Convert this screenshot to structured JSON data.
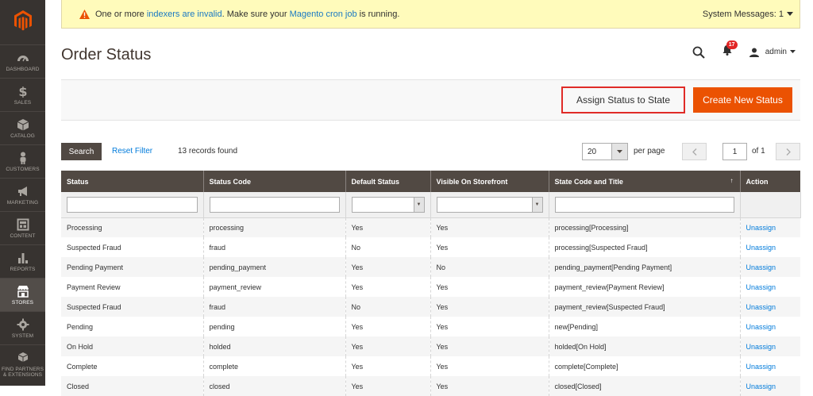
{
  "sidebar": {
    "items": [
      {
        "label": "DASHBOARD",
        "icon": "dashboard-icon"
      },
      {
        "label": "SALES",
        "icon": "dollar-icon"
      },
      {
        "label": "CATALOG",
        "icon": "box-icon"
      },
      {
        "label": "CUSTOMERS",
        "icon": "person-icon"
      },
      {
        "label": "MARKETING",
        "icon": "megaphone-icon"
      },
      {
        "label": "CONTENT",
        "icon": "layout-icon"
      },
      {
        "label": "REPORTS",
        "icon": "bar-chart-icon"
      },
      {
        "label": "STORES",
        "icon": "store-icon"
      },
      {
        "label": "SYSTEM",
        "icon": "gear-icon"
      },
      {
        "label": "FIND PARTNERS & EXTENSIONS",
        "icon": "cubes-icon"
      }
    ],
    "active": "STORES"
  },
  "system_message": {
    "text_1": "One or more ",
    "link_1": "indexers are invalid",
    "text_2": ". Make sure your ",
    "link_2": "Magento cron job",
    "text_3": " is running.",
    "right_label": "System Messages: 1"
  },
  "header": {
    "title": "Order Status",
    "notification_count": "17",
    "user": "admin"
  },
  "actions": {
    "assign_label": "Assign Status to State",
    "create_label": "Create New Status"
  },
  "toolbar": {
    "search_label": "Search",
    "reset_label": "Reset Filter",
    "records": "13 records found",
    "per_page_value": "20",
    "per_page_label": "per page",
    "page_value": "1",
    "page_of": "of 1"
  },
  "table": {
    "headers": [
      "Status",
      "Status Code",
      "Default Status",
      "Visible On Storefront",
      "State Code and Title",
      "Action"
    ],
    "rows": [
      [
        "Processing",
        "processing",
        "Yes",
        "Yes",
        "processing[Processing]",
        "Unassign"
      ],
      [
        "Suspected Fraud",
        "fraud",
        "No",
        "Yes",
        "processing[Suspected Fraud]",
        "Unassign"
      ],
      [
        "Pending Payment",
        "pending_payment",
        "Yes",
        "No",
        "pending_payment[Pending Payment]",
        "Unassign"
      ],
      [
        "Payment Review",
        "payment_review",
        "Yes",
        "Yes",
        "payment_review[Payment Review]",
        "Unassign"
      ],
      [
        "Suspected Fraud",
        "fraud",
        "No",
        "Yes",
        "payment_review[Suspected Fraud]",
        "Unassign"
      ],
      [
        "Pending",
        "pending",
        "Yes",
        "Yes",
        "new[Pending]",
        "Unassign"
      ],
      [
        "On Hold",
        "holded",
        "Yes",
        "Yes",
        "holded[On Hold]",
        "Unassign"
      ],
      [
        "Complete",
        "complete",
        "Yes",
        "Yes",
        "complete[Complete]",
        "Unassign"
      ],
      [
        "Closed",
        "closed",
        "Yes",
        "Yes",
        "closed[Closed]",
        "Unassign"
      ]
    ]
  },
  "colors": {
    "sidebar_bg": "#373330",
    "accent": "#eb5202",
    "header_bg": "#514943",
    "link": "#007bdb"
  }
}
